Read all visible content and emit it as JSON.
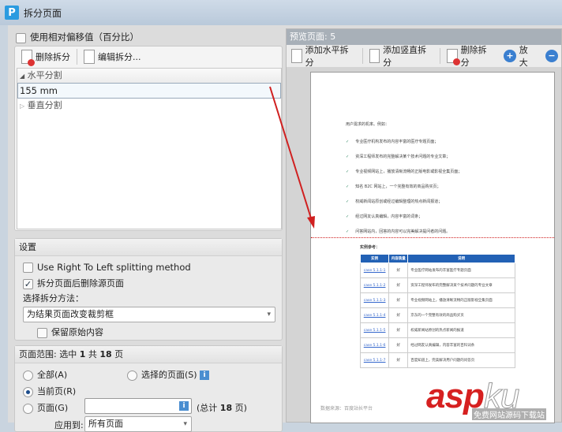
{
  "window": {
    "title": "拆分页面",
    "logo": "P"
  },
  "left": {
    "relative_offset": "使用相对偏移值（百分比）",
    "toolbar": {
      "delete": "删除拆分",
      "edit": "编辑拆分..."
    },
    "tree": {
      "horizontal": "水平分割",
      "value": "155 mm",
      "vertical": "垂直分割"
    },
    "settings": {
      "header": "设置",
      "rtl": "Use Right To Left splitting method",
      "delete_source": "拆分页面后删除源页面",
      "method_label": "选择拆分方法：",
      "method_value": "为结果页面改变裁剪框",
      "keep_original": "保留原始内容"
    },
    "range": {
      "header_prefix": "页面范围: 选中",
      "selected": "1",
      "mid": "共",
      "total": "18",
      "suffix": "页",
      "all": "全部(A)",
      "selected_pages": "选择的页面(S)",
      "current": "当前页(R)",
      "pages": "页面(G)",
      "total_label_prefix": "(总计",
      "total_label_suffix": "页)",
      "apply_label": "应用到:",
      "apply_value": "所有页面"
    }
  },
  "right": {
    "header": "预览页面: 5",
    "toolbar": {
      "add_h": "添加水平拆分",
      "add_v": "添加竖直拆分",
      "delete": "删除拆分",
      "zoom_in": "放大"
    },
    "page": {
      "intro": "用户需求的机率。例如：",
      "bullets": [
        "专业医疗机构发布的内容丰富的医疗专题页面；",
        "资深工程师发布的完整解决某个技术问题的专业文章；",
        "专业视频网站上，播放清晰流畅的正版电影或影视全集页面；",
        "知名 B2C 网站上，一个完整有效的商品购买页；",
        "权威新闻站原创或经过编辑整理的热点新闻报道；",
        "经过网友认真编辑，内容丰富的词条；",
        "问答网站内，回答的内容可以完美解决提问者的问题。"
      ],
      "ref_title": "实例参考：",
      "columns": [
        "实例",
        "内容质量",
        "说明"
      ],
      "rows": [
        [
          "case 5.1.1-1",
          "好",
          "专业医疗网站发布的丰富医疗专题页面"
        ],
        [
          "case 5.1.1-2",
          "好",
          "资深工程师发布的完整解决某个技术问题的专业文章"
        ],
        [
          "case 5.1.1-3",
          "好",
          "专业视频网站上，播放清晰流畅的正版影视全集页面"
        ],
        [
          "case 5.1.1-4",
          "好",
          "京东的一个完整有效的商品购买页"
        ],
        [
          "case 5.1.1-5",
          "好",
          "权威新闻站原创的热点新闻的报道"
        ],
        [
          "case 5.1.1-6",
          "好",
          "经过网友认真编辑，内容丰富的百科词条"
        ],
        [
          "case 5.1.1-7",
          "好",
          "百度知道上，完美解决用户问题的问答页"
        ]
      ],
      "source": "数据来源：百度站长平台"
    }
  },
  "watermark": {
    "brand": "aspku",
    "tagline": "免费网站源码下载站"
  },
  "colors": {
    "split_line": "#d02020",
    "table_header": "#2261b5"
  }
}
